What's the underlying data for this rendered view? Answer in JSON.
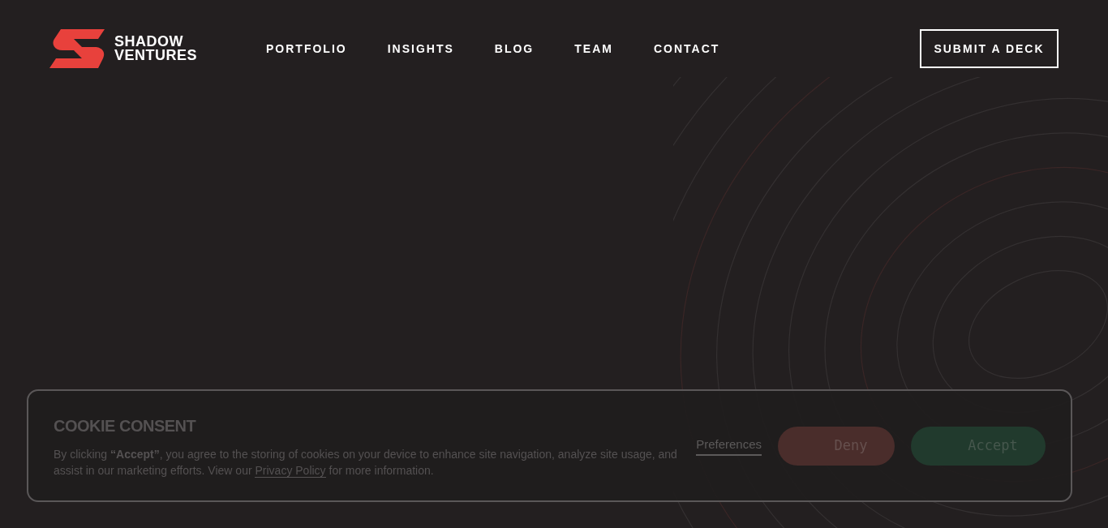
{
  "logo": {
    "lines": [
      "SHADOW",
      "VENTURES"
    ]
  },
  "nav": {
    "items": [
      "PORTFOLIO",
      "INSIGHTS",
      "BLOG",
      "TEAM",
      "CONTACT"
    ]
  },
  "cta": {
    "label": "SUBMIT A DECK"
  },
  "cookie_banner": {
    "title": "COOKIE CONSENT",
    "text_before": "By clicking **“Accept”**, you agree to the storing of cookies on your device to enhance site navigation, analyze site usage, and assist in our marketing efforts. View our",
    "link": "Privacy Policy",
    "text_after": "for more information.",
    "preferences": "Preferences",
    "deny": "Deny",
    "accept": "Accept"
  }
}
